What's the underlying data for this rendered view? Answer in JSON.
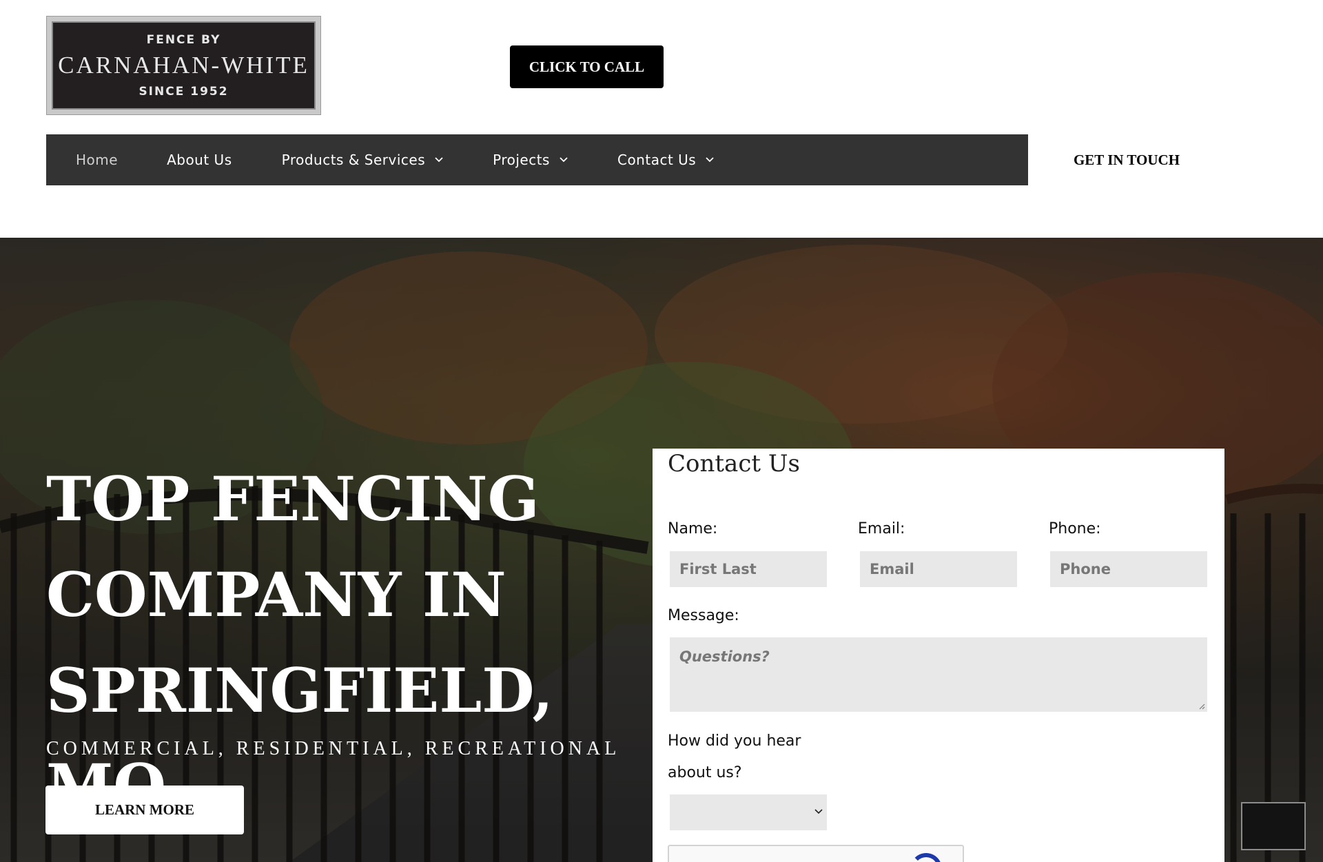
{
  "header": {
    "logo": {
      "top": "FENCE BY",
      "name": "CARNAHAN-WHITE",
      "bottom": "SINCE 1952"
    },
    "call_button": "CLICK TO CALL",
    "get_in_touch": "GET IN TOUCH"
  },
  "nav": {
    "items": [
      {
        "label": "Home",
        "dropdown": false,
        "active": true
      },
      {
        "label": "About Us",
        "dropdown": false
      },
      {
        "label": "Products & Services",
        "dropdown": true
      },
      {
        "label": "Projects",
        "dropdown": true
      },
      {
        "label": "Contact Us",
        "dropdown": true
      }
    ]
  },
  "hero": {
    "title_lines": [
      "TOP FENCING",
      "COMPANY IN",
      "SPRINGFIELD, MO"
    ],
    "subtitle": "COMMERCIAL, RESIDENTIAL, RECREATIONAL",
    "cta": "LEARN MORE"
  },
  "contact_form": {
    "title": "Contact Us",
    "name_label": "Name:",
    "name_placeholder": "First Last",
    "email_label": "Email:",
    "email_placeholder": "Email",
    "phone_label": "Phone:",
    "phone_placeholder": "Phone",
    "message_label": "Message:",
    "message_placeholder": "Questions?",
    "hear_label_1": "How did you hear",
    "hear_label_2": "about us?",
    "hear_selected": ""
  },
  "colors": {
    "nav_bg": "#333333",
    "button_dark": "#000000",
    "input_bg": "#e8e8e8"
  }
}
